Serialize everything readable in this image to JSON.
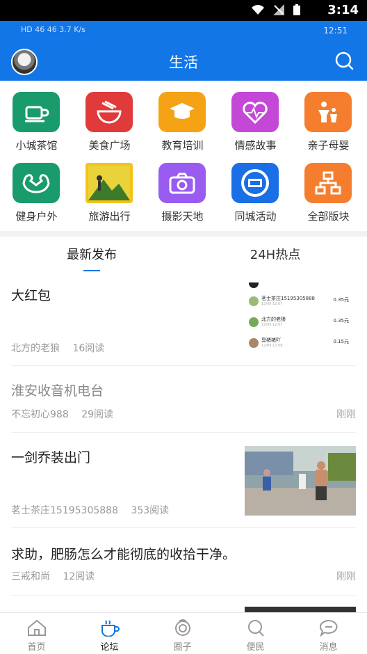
{
  "status_bar": {
    "time": "3:14"
  },
  "inner_status": {
    "left": "HD 46 46 3.7 K/s",
    "time": "12:51"
  },
  "header": {
    "title": "生活"
  },
  "categories": [
    {
      "label": "小城茶馆",
      "color": "#1a9b6b"
    },
    {
      "label": "美食广场",
      "color": "#e03a3a"
    },
    {
      "label": "教育培训",
      "color": "#f5a214"
    },
    {
      "label": "情感故事",
      "color": "#c447d8"
    },
    {
      "label": "亲子母婴",
      "color": "#f57e2e"
    },
    {
      "label": "健身户外",
      "color": "#1a9b6b"
    },
    {
      "label": "旅游出行",
      "color": "#f4c21a"
    },
    {
      "label": "摄影天地",
      "color": "#9a5bf0"
    },
    {
      "label": "同城活动",
      "color": "#1a6fe6"
    },
    {
      "label": "全部版块",
      "color": "#f57e2e"
    }
  ],
  "tabs": [
    {
      "label": "最新发布"
    },
    {
      "label": "24H热点"
    }
  ],
  "posts": [
    {
      "title": "大红包",
      "author": "北方的老狼",
      "reads": "16阅读",
      "time": ""
    },
    {
      "title": "淮安收音机电台",
      "author": "不忘初心988",
      "reads": "29阅读",
      "time": "刚刚"
    },
    {
      "title": "一剑乔装出门",
      "author": "茗士茶庄15195305888",
      "reads": "353阅读",
      "time": ""
    },
    {
      "title": "求助，肥肠怎么才能彻底的收拾干净。",
      "author": "三戒和尚",
      "reads": "12阅读",
      "time": "刚刚"
    }
  ],
  "redpacket_list": [
    {
      "name": "茗士茶庄15195305888",
      "date": "12/09 12:07",
      "amount": "0.35元"
    },
    {
      "name": "北方的老狼",
      "date": "12/09 12:07",
      "amount": "0.35元"
    },
    {
      "name": "臭猪猪吖",
      "date": "12/09 12:08",
      "amount": "0.15元"
    }
  ],
  "bottom_nav": [
    {
      "label": "首页"
    },
    {
      "label": "论坛"
    },
    {
      "label": "圈子"
    },
    {
      "label": "便民"
    },
    {
      "label": "消息"
    }
  ]
}
